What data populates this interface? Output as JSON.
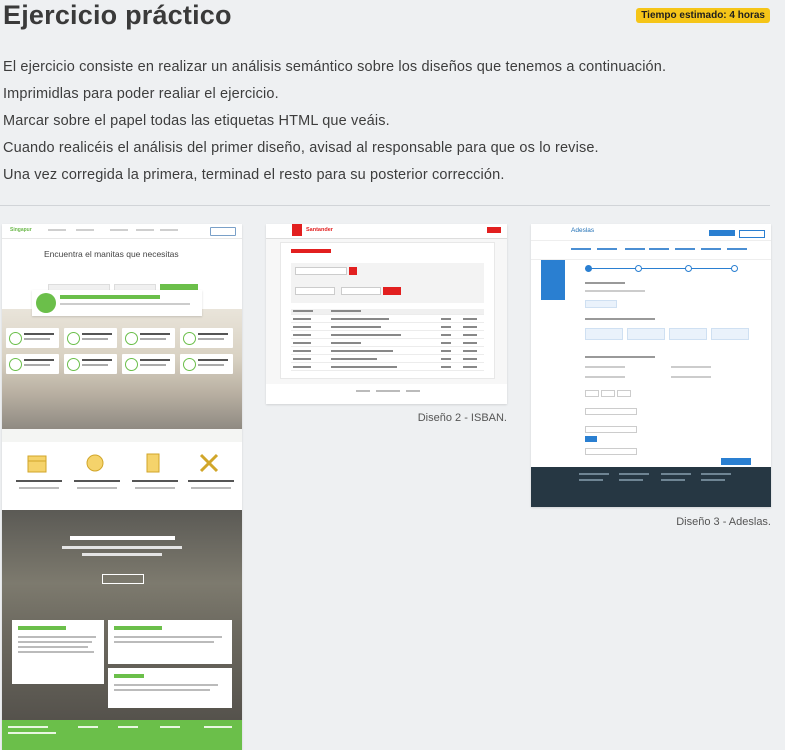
{
  "header": {
    "title": "Ejercicio práctico",
    "badge": "Tiempo estimado: 4 horas"
  },
  "intro": [
    "El ejercicio consiste en realizar un análisis semántico sobre los diseños que tenemos a continuación.",
    "Imprimidlas para poder realiar el ejercicio.",
    "Marcar sobre el papel todas las etiquetas HTML que veáis.",
    "Cuando realicéis el análisis del primer diseño, avisad al responsable para que os lo revise.",
    "Una vez corregida la primera, terminad el resto para su posterior corrección."
  ],
  "designs": [
    {
      "caption": "",
      "screen": {
        "logo": "Singapur",
        "hero_title": "Encuentra el manitas que necesitas",
        "popup_title": "No te preocupes, nosotros lo solucionamos",
        "card_titles": [
          "Montaje de muebles de cocina",
          "Colgar cuadros",
          "Tapizado de mobiliario",
          "Iluminación del hogar",
          "Decoración de vivienda completa",
          "Decoración de salón",
          "Decoración de dormitorio",
          "Decoración de baño completo"
        ],
        "features": [
          "Reserva fácilmente",
          "Garantía de calidad",
          "Precio por adelantado",
          "Los mejores profesionales"
        ],
        "company_title": "¿Tienes una empresa?",
        "reviews": [
          "Muy recomendable",
          "Todo perfecto",
          "Repetiré"
        ],
        "footer_title": "¿Eres un profesional?"
      }
    },
    {
      "caption": "Diseño 2 - ISBAN.",
      "screen": {
        "brand": "Santander",
        "panel_title": "Account Details"
      }
    },
    {
      "caption": "Diseño 3 - Adeslas.",
      "screen": {
        "logo": "Adeslas"
      }
    }
  ],
  "colors": {
    "badge": "#f5c518",
    "singapur_green": "#6bbf4a",
    "santander_red": "#e21f1f",
    "adeslas_blue": "#2a7fd1"
  }
}
